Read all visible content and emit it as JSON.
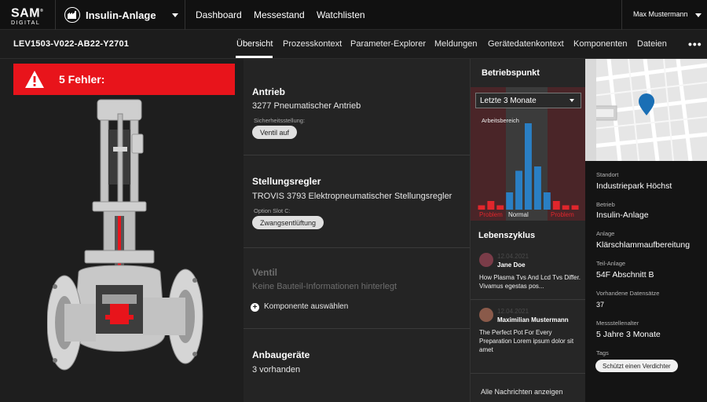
{
  "header": {
    "logo_big": "SAM",
    "logo_small": "DIGITAL",
    "logo_reg": "®",
    "app_name": "Insulin-Anlage",
    "nav": [
      "Dashboard",
      "Messestand",
      "Watchlisten"
    ],
    "user": "Max Mustermann"
  },
  "subheader": {
    "device_id": "LEV1503-V022-AB22-Y2701",
    "tabs": [
      "Übersicht",
      "Prozesskontext",
      "Parameter-Explorer",
      "Meldungen",
      "Gerätedatenkontext",
      "Komponenten",
      "Dateien"
    ],
    "active_tab": "Übersicht",
    "more": "•••"
  },
  "errors": {
    "label": "5 Fehler:",
    "color": "#e8141b"
  },
  "components": {
    "antrieb": {
      "title": "Antrieb",
      "value": "3277 Pneumatischer Antrieb",
      "sub_label": "Sicherheitsstellung:",
      "chip": "Ventil auf"
    },
    "stellungsregler": {
      "title": "Stellungsregler",
      "value": "TROVIS 3793 Elektropneumatischer Stellungsregler",
      "sub_label": "Option Slot C:",
      "chip": "Zwangsentlüftung"
    },
    "ventil": {
      "title": "Ventil",
      "value": "Keine Bauteil-Informationen hinterlegt",
      "action": "Komponente auswählen"
    },
    "anbaugeraete": {
      "title": "Anbaugeräte",
      "value": "3 vorhanden"
    }
  },
  "operating_point": {
    "title": "Betriebspunkt",
    "range_select": "Letzte 3 Monate",
    "subtitle": "Arbeitsbereich",
    "label_problem": "Problem",
    "label_normal": "Normal",
    "problem_color": "#e0262c",
    "normal_color": "#2a7fc4",
    "chart_data": {
      "type": "bar",
      "segments": [
        "problem",
        "problem",
        "problem",
        "normal",
        "normal",
        "normal",
        "normal",
        "normal",
        "problem",
        "problem",
        "problem"
      ],
      "values": [
        1,
        2,
        1,
        4,
        9,
        20,
        10,
        4,
        2,
        1,
        1
      ]
    }
  },
  "lifecycle": {
    "title": "Lebenszyklus",
    "messages": [
      {
        "date": "12.04.2021",
        "name": "Jane Doe",
        "text": "How Plasma Tvs And Lcd Tvs Differ. Vivamus egestas pos..."
      },
      {
        "date": "12.04.2021",
        "name": "Maximilian Mustermann",
        "text": "The Perfect Pot For Every Preparation Lorem ipsum dolor sit amet"
      }
    ],
    "all_link": "Alle Nachrichten anzeigen"
  },
  "location": {
    "pin_color": "#1a6fb5",
    "fields": [
      {
        "label": "Standort",
        "value": "Industriepark Höchst"
      },
      {
        "label": "Betrieb",
        "value": "Insulin-Anlage"
      },
      {
        "label": "Anlage",
        "value": "Klärschlammaufbereitung"
      },
      {
        "label": "Teil-Anlage",
        "value": "54F Abschnitt B"
      },
      {
        "label": "Vorhandene Datensätze",
        "value": "37"
      },
      {
        "label": "Messstellenalter",
        "value": "5 Jahre 3 Monate"
      },
      {
        "label": "Tags",
        "value": ""
      }
    ],
    "tag": "Schützt einen Verdichter"
  }
}
